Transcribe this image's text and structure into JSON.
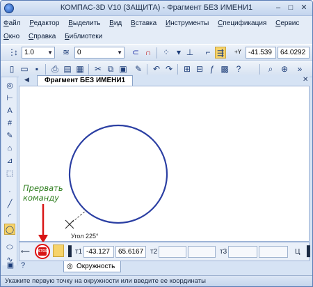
{
  "window": {
    "title": "КОМПАС-3D V10 (ЗАЩИТА) - Фрагмент БЕЗ ИМЕНИ1",
    "minimize_glyph": "–",
    "maximize_glyph": "□",
    "close_glyph": "✕"
  },
  "menu": {
    "row1": [
      "Файл",
      "Редактор",
      "Выделить",
      "Вид",
      "Вставка",
      "Инструменты",
      "Спецификация",
      "Сервис"
    ],
    "row2": [
      "Окно",
      "Справка",
      "Библиотеки"
    ]
  },
  "toolbar_props": {
    "line_width": "1.0",
    "layer": "0",
    "coord_x": "-41.539",
    "coord_y": "64.0292",
    "coord_xy_label": "+Y"
  },
  "document": {
    "tab_title": "Фрагмент БЕЗ ИМЕНИ1",
    "cursor_label": "Угол 225°"
  },
  "annotation": {
    "text_line1": "Прервать",
    "text_line2": "команду"
  },
  "properties": {
    "t1_label": "т1",
    "t1_x": "-43.127",
    "t1_y": "65.6167",
    "t2_label": "т2",
    "t3_label": "т3",
    "c_label": "Ц"
  },
  "bottom_tab": {
    "label": "Окружность"
  },
  "status": {
    "text": "Укажите первую точку на окружности или введите ее координаты"
  },
  "colors": {
    "circle_stroke": "#2b3fa3",
    "annotation": "#2e7d1e",
    "stop": "#e01010"
  }
}
